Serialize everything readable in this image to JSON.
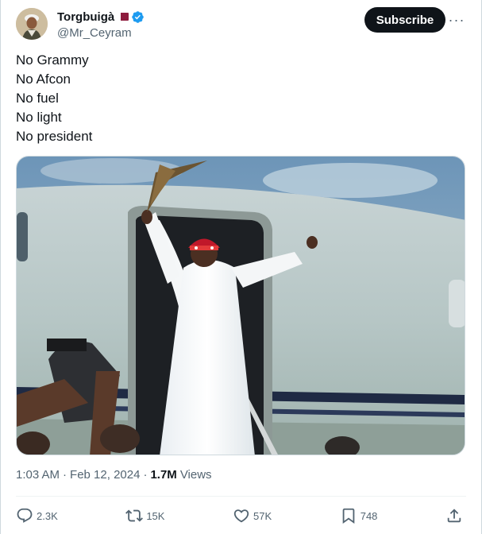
{
  "author": {
    "display_name": "Torgbuigà",
    "handle": "@Mr_Ceyram",
    "verified": true,
    "flag_icon": "qatar-flag-icon"
  },
  "header": {
    "subscribe_label": "Subscribe",
    "more_label": "···"
  },
  "tweet": {
    "lines": [
      "No Grammy",
      "No Afcon",
      "No fuel",
      "No light",
      "No president"
    ]
  },
  "meta": {
    "time": "1:03 AM",
    "separator": "·",
    "date": "Feb 12, 2024",
    "separator2": "·",
    "views_count": "1.7M",
    "views_label": "Views"
  },
  "actions": {
    "replies": "2.3K",
    "reposts": "15K",
    "likes": "57K",
    "bookmarks": "748"
  },
  "colors": {
    "verified_blue": "#1d9bf0",
    "secondary_text": "#536471",
    "primary_text": "#0f1419"
  }
}
